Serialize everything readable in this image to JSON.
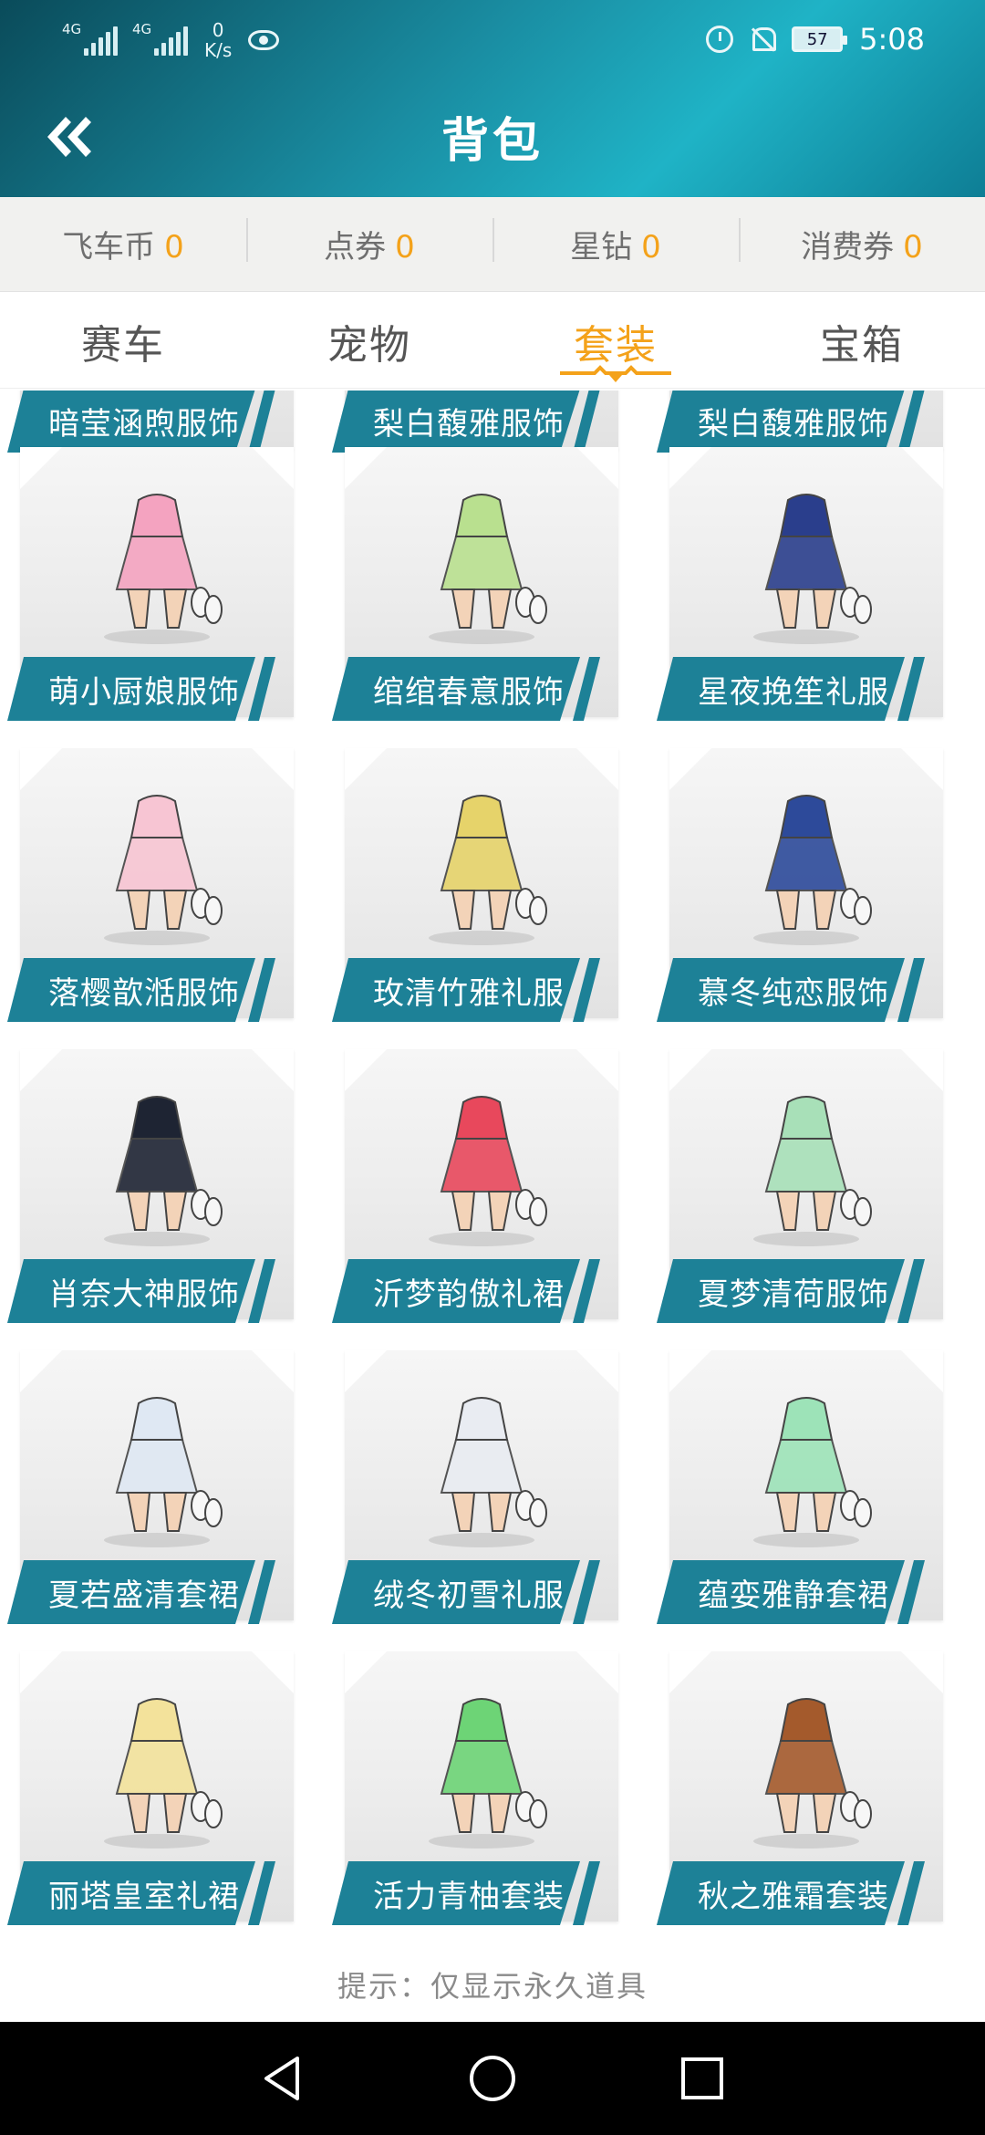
{
  "status_bar": {
    "signal_1": "4G",
    "signal_2": "4G",
    "net_speed_value": "0",
    "net_speed_unit": "K/s",
    "battery": "57",
    "time": "5:08"
  },
  "header": {
    "title": "背包",
    "back_icon": "double-chevron-left-icon"
  },
  "currency": [
    {
      "label": "飞车币",
      "value": "0"
    },
    {
      "label": "点券",
      "value": "0"
    },
    {
      "label": "星钻",
      "value": "0"
    },
    {
      "label": "消费券",
      "value": "0"
    }
  ],
  "tabs": [
    {
      "label": "赛车",
      "active": false
    },
    {
      "label": "宠物",
      "active": false
    },
    {
      "label": "套装",
      "active": true
    },
    {
      "label": "宝箱",
      "active": false
    }
  ],
  "partial_row": [
    "暗莹涵煦服饰",
    "梨白馥雅服饰",
    "梨白馥雅服饰"
  ],
  "items": [
    {
      "name": "萌小厨娘服饰",
      "color": "#f4a3c0"
    },
    {
      "name": "绾绾春意服饰",
      "color": "#b9e08f"
    },
    {
      "name": "星夜挽笙礼服",
      "color": "#2a3e8c"
    },
    {
      "name": "落樱歆湉服饰",
      "color": "#f7c5d3"
    },
    {
      "name": "玫清竹雅礼服",
      "color": "#e6d36a"
    },
    {
      "name": "慕冬纯恋服饰",
      "color": "#2d4a9a"
    },
    {
      "name": "肖奈大神服饰",
      "color": "#1e2433"
    },
    {
      "name": "沂梦韵傲礼裙",
      "color": "#e8485c"
    },
    {
      "name": "夏梦清荷服饰",
      "color": "#a8e0b8"
    },
    {
      "name": "夏若盛清套裙",
      "color": "#dfe8f3"
    },
    {
      "name": "绒冬初雪礼服",
      "color": "#e9ecf2"
    },
    {
      "name": "蕴娈雅静套裙",
      "color": "#9de3b8"
    },
    {
      "name": "丽塔皇室礼裙",
      "color": "#f3e29b"
    },
    {
      "name": "活力青柚套装",
      "color": "#6dd476"
    },
    {
      "name": "秋之雅霜套装",
      "color": "#a45a2c"
    }
  ],
  "hint": "提示：仅显示永久道具",
  "navbar": {
    "back": "triangle-back-icon",
    "home": "circle-home-icon",
    "recents": "square-recents-icon"
  },
  "colors": {
    "accent": "#f4a21a",
    "teal": "#1d8197"
  }
}
